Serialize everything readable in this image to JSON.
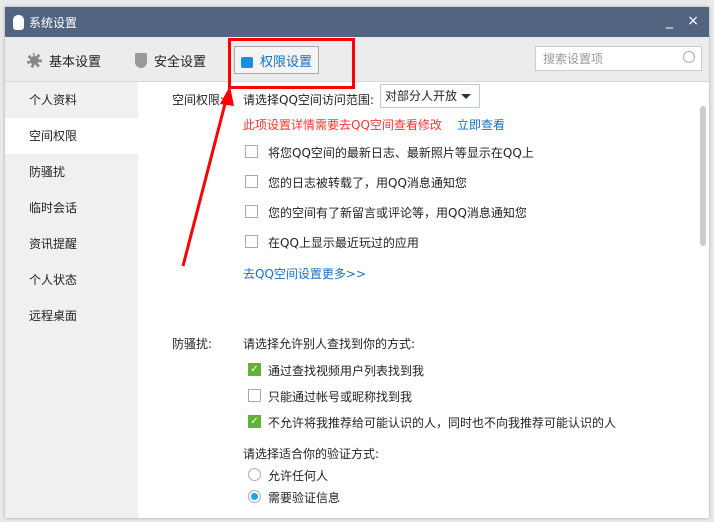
{
  "window": {
    "title": "系统设置",
    "minimize": "_",
    "close": "×"
  },
  "toolbar": {
    "tabs": [
      {
        "label": "基本设置"
      },
      {
        "label": "安全设置"
      },
      {
        "label": "权限设置"
      }
    ],
    "search_placeholder": "搜索设置项"
  },
  "sidebar": {
    "items": [
      {
        "label": "个人资料"
      },
      {
        "label": "空间权限"
      },
      {
        "label": "防骚扰"
      },
      {
        "label": "临时会话"
      },
      {
        "label": "资讯提醒"
      },
      {
        "label": "个人状态"
      },
      {
        "label": "远程桌面"
      }
    ]
  },
  "space": {
    "label": "空间权限:",
    "scope_label": "请选择QQ空间访问范围:",
    "scope_value": "对部分人开放",
    "warning": "此项设置详情需要去QQ空间查看修改",
    "view_now": "立即查看",
    "options": [
      {
        "label": "将您QQ空间的最新日志、最新照片等显示在QQ上",
        "checked": false
      },
      {
        "label": "您的日志被转载了，用QQ消息通知您",
        "checked": false
      },
      {
        "label": "您的空间有了新留言或评论等，用QQ消息通知您",
        "checked": false
      },
      {
        "label": "在QQ上显示最近玩过的应用",
        "checked": false
      }
    ],
    "more_link": "去QQ空间设置更多>>"
  },
  "harass": {
    "label": "防骚扰:",
    "find_label": "请选择允许别人查找到你的方式:",
    "find_options": [
      {
        "label": "通过查找视频用户列表找到我",
        "checked": true
      },
      {
        "label": "只能通过帐号或昵称找到我",
        "checked": false
      },
      {
        "label": "不允许将我推荐给可能认识的人，同时也不向我推荐可能认识的人",
        "checked": true
      }
    ],
    "verify_label": "请选择适合你的验证方式:",
    "verify_options": [
      {
        "label": "允许任何人",
        "selected": false
      },
      {
        "label": "需要验证信息",
        "selected": true
      }
    ]
  },
  "colors": {
    "titlebar": "#536480",
    "accent": "#1a6fc1",
    "warning": "#f33",
    "annotation": "#ff0000"
  }
}
